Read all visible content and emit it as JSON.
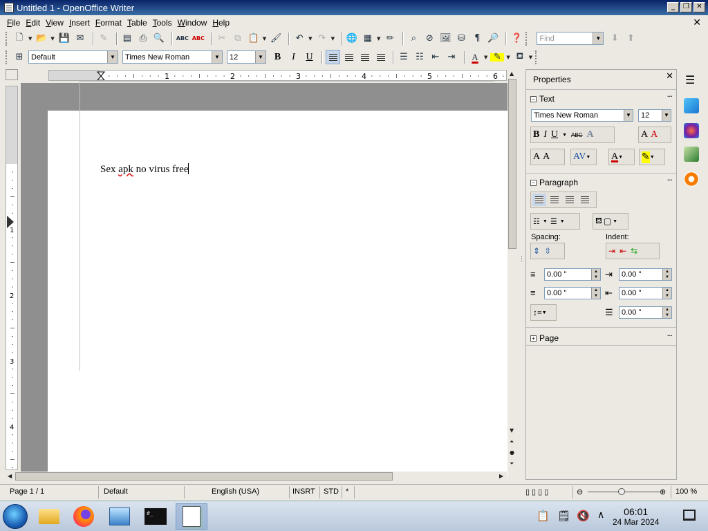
{
  "window": {
    "title": "Untitled 1 - OpenOffice Writer"
  },
  "menu": [
    {
      "label": "File",
      "key": "F",
      "rest": "ile"
    },
    {
      "label": "Edit",
      "key": "E",
      "rest": "dit"
    },
    {
      "label": "View",
      "key": "V",
      "rest": "iew"
    },
    {
      "label": "Insert",
      "key": "I",
      "rest": "nsert"
    },
    {
      "label": "Format",
      "key": "F",
      "rest": "ormat"
    },
    {
      "label": "Table",
      "key": "T",
      "rest": "able"
    },
    {
      "label": "Tools",
      "key": "T",
      "rest": "ools"
    },
    {
      "label": "Window",
      "key": "W",
      "rest": "indow"
    },
    {
      "label": "Help",
      "key": "H",
      "rest": "elp"
    }
  ],
  "find": {
    "placeholder": "Find"
  },
  "formatting": {
    "style": "Default",
    "font": "Times New Roman",
    "size": "12",
    "bold": "B",
    "italic": "I",
    "underline": "U"
  },
  "ruler": {
    "h_numbers": [
      "1",
      "2",
      "3",
      "4",
      "5",
      "6"
    ],
    "v_numbers": [
      "1",
      "2",
      "3",
      "4"
    ]
  },
  "document": {
    "text_a": "Sex ",
    "text_b": "apk",
    "text_c": " no virus free"
  },
  "sidebar": {
    "title": "Properties",
    "text_section": "Text",
    "font": "Times New Roman",
    "size": "12",
    "paragraph_section": "Paragraph",
    "spacing_label": "Spacing:",
    "indent_label": "Indent:",
    "spacing_above": "0.00 \"",
    "spacing_below": "0.00 \"",
    "indent_before": "0.00 \"",
    "indent_after": "0.00 \"",
    "first_line": "0.00 \"",
    "page_section": "Page"
  },
  "status": {
    "page": "Page 1 / 1",
    "style": "Default",
    "language": "English (USA)",
    "insert": "INSRT",
    "select": "STD",
    "modified": "*",
    "zoom": "100 %"
  },
  "taskbar": {
    "time": "06:01",
    "date": "24 Mar 2024"
  }
}
